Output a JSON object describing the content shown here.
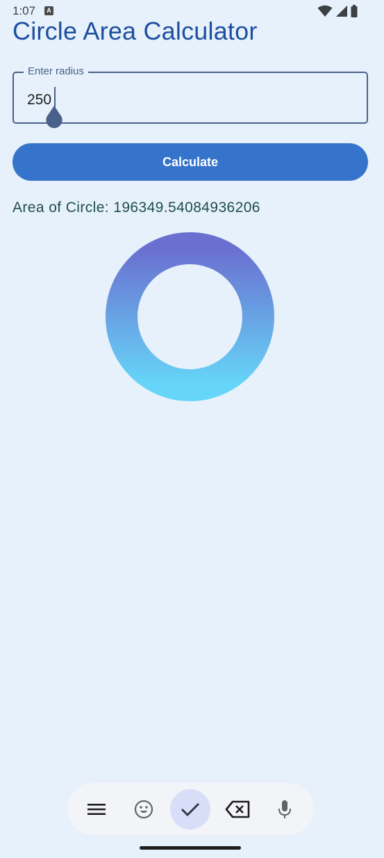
{
  "status": {
    "time": "1:07",
    "notification_icon_letter": "A"
  },
  "app": {
    "title": "Circle Area Calculator"
  },
  "form": {
    "radius_label": "Enter radius",
    "radius_value": "250"
  },
  "actions": {
    "calculate_label": "Calculate"
  },
  "result": {
    "text": "Area of Circle: 196349.54084936206"
  },
  "colors": {
    "background": "#e6f1fb",
    "title": "#1e4fa0",
    "button": "#3674cc",
    "result_text": "#1f4e4a",
    "ring_top": "#6a6fd0",
    "ring_bottom": "#66d6f8"
  },
  "keyboard_toolbar": {
    "icons": [
      "menu-icon",
      "emoji-icon",
      "check-icon",
      "backspace-icon",
      "microphone-icon"
    ],
    "active": "check-icon"
  }
}
